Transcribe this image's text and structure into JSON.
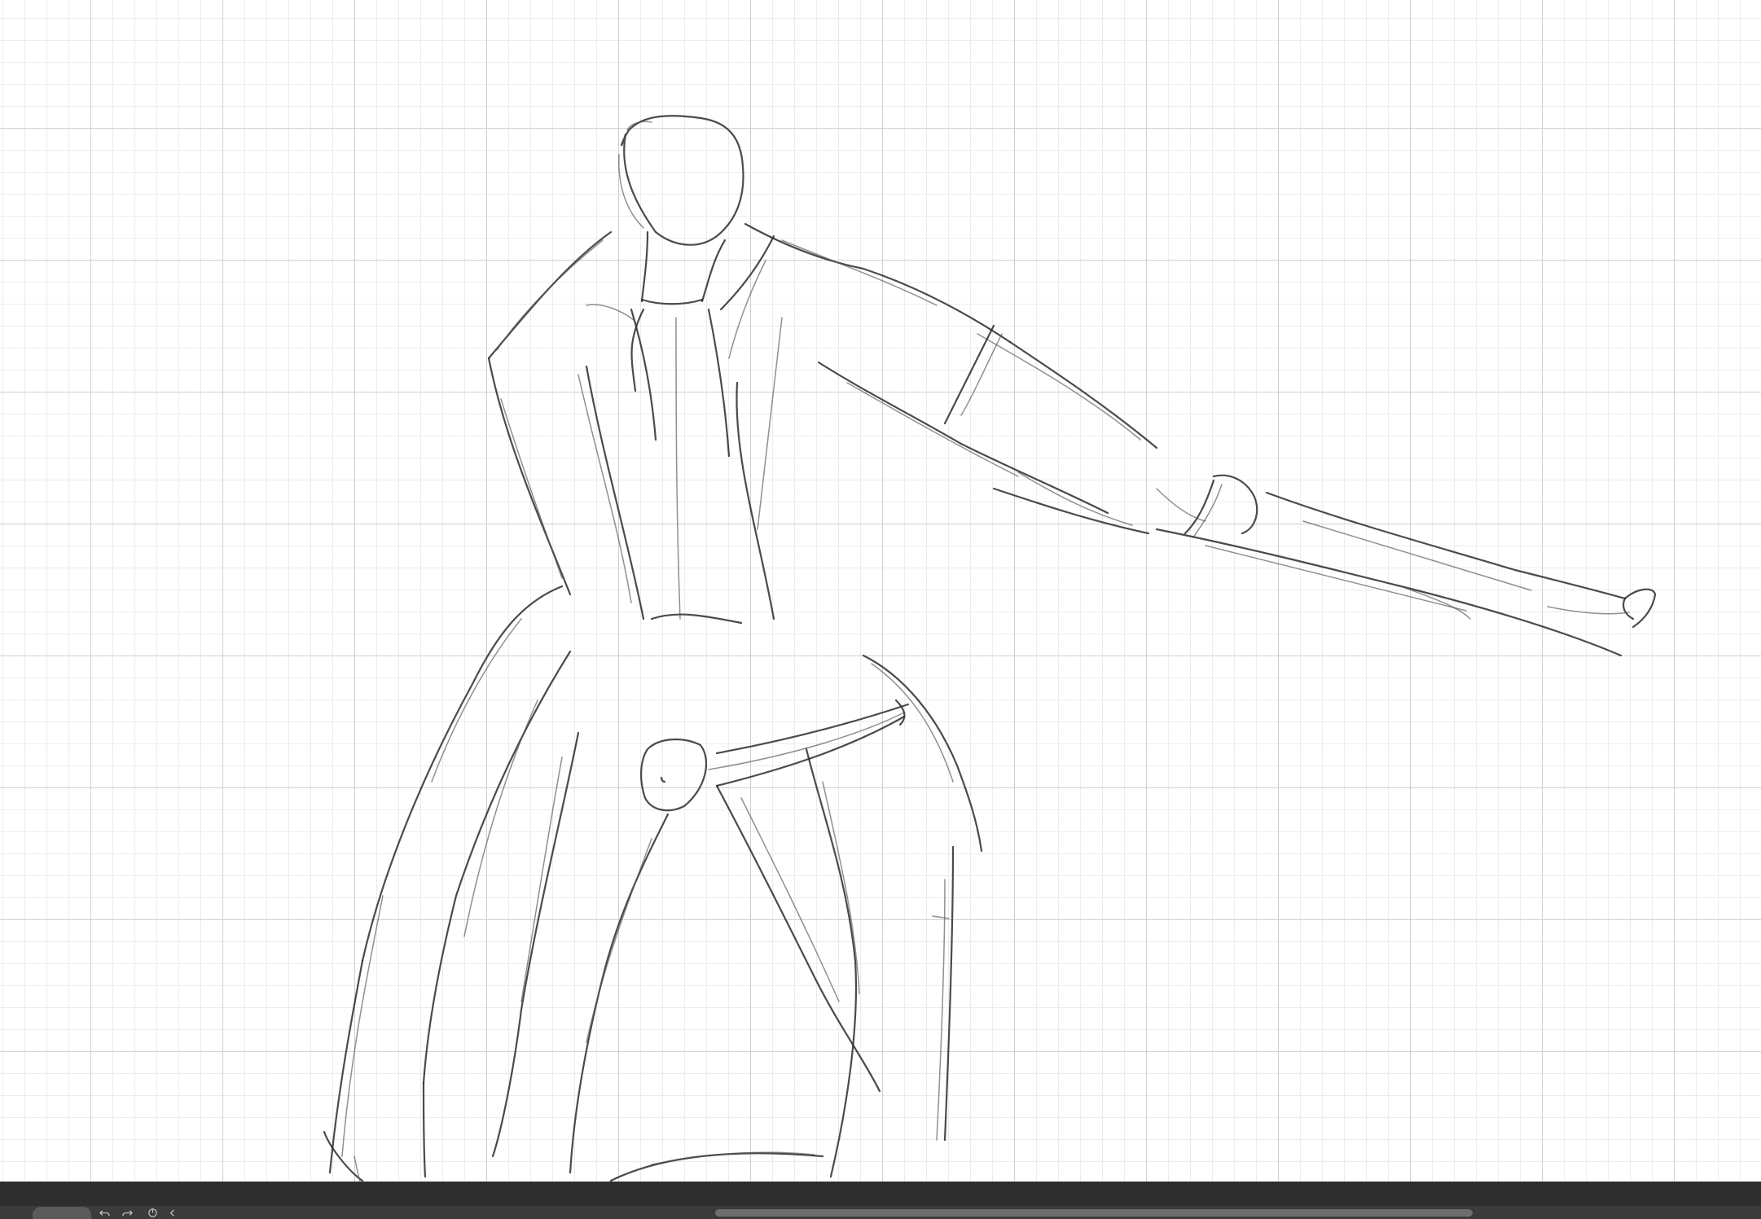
{
  "canvas": {
    "background": "#ffffff",
    "grid_color": "#cfcfcf",
    "subgrid_color": "#ececec",
    "stroke_color": "#2c2c2c"
  },
  "bottom_bar": {
    "background": "#2e2e2e",
    "tools": [
      {
        "icon": "undo-icon"
      },
      {
        "icon": "redo-icon"
      },
      {
        "icon": "rotate-reset-icon"
      },
      {
        "icon": "chevron-left-icon"
      }
    ],
    "scrollbar_color": "#6e6e6e"
  }
}
